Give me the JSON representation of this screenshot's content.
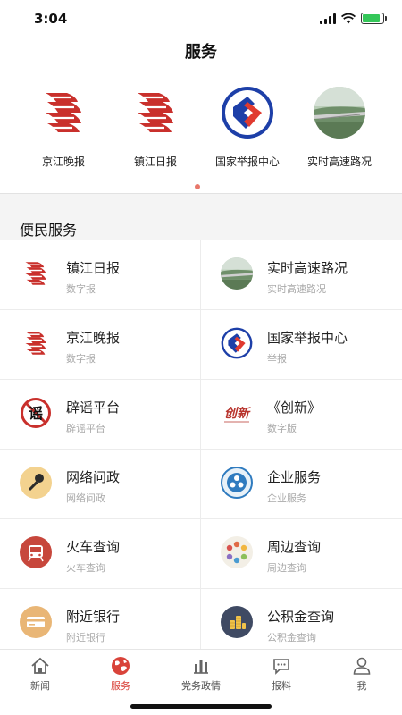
{
  "status_bar": {
    "time": "3:04",
    "battery_level": 0.85,
    "battery_color": "#34c759"
  },
  "header": {
    "title": "服务"
  },
  "carousel": {
    "items": [
      {
        "label": "京江晚报",
        "icon": "jingjiang-evening-news-logo"
      },
      {
        "label": "镇江日报",
        "icon": "zhenjiang-daily-logo"
      },
      {
        "label": "国家举报中心",
        "icon": "national-report-center-logo"
      },
      {
        "label": "实时高速路况",
        "icon": "highway-traffic-photo"
      }
    ],
    "active_page": 1,
    "page_count": 1
  },
  "section": {
    "title": "便民服务"
  },
  "services": [
    {
      "title": "镇江日报",
      "subtitle": "数字报",
      "icon": "zhenjiang-daily-logo"
    },
    {
      "title": "实时高速路况",
      "subtitle": "实时高速路况",
      "icon": "highway-traffic-photo"
    },
    {
      "title": "京江晚报",
      "subtitle": "数字报",
      "icon": "jingjiang-evening-news-logo"
    },
    {
      "title": "国家举报中心",
      "subtitle": "举报",
      "icon": "national-report-center-logo"
    },
    {
      "title": "辟谣平台",
      "subtitle": "辟谣平台",
      "icon": "rumor-refute-logo",
      "logo_text": "谣"
    },
    {
      "title": "《创新》",
      "subtitle": "数字版",
      "icon": "innovation-magazine-logo",
      "logo_text": "创新"
    },
    {
      "title": "网络问政",
      "subtitle": "网络问政",
      "icon": "microphone-icon"
    },
    {
      "title": "企业服务",
      "subtitle": "企业服务",
      "icon": "enterprise-service-icon"
    },
    {
      "title": "火车查询",
      "subtitle": "火车查询",
      "icon": "train-icon"
    },
    {
      "title": "周边查询",
      "subtitle": "周边查询",
      "icon": "nearby-icon"
    },
    {
      "title": "附近银行",
      "subtitle": "附近银行",
      "icon": "bank-card-icon"
    },
    {
      "title": "公积金查询",
      "subtitle": "公积金查询",
      "icon": "coins-icon"
    }
  ],
  "tabbar": {
    "active_color": "#d9433a",
    "tabs": [
      {
        "label": "新闻",
        "icon": "home-icon",
        "active": false
      },
      {
        "label": "服务",
        "icon": "globe-icon",
        "active": true
      },
      {
        "label": "党务政情",
        "icon": "building-icon",
        "active": false
      },
      {
        "label": "报料",
        "icon": "chat-bubble-icon",
        "active": false
      },
      {
        "label": "我",
        "icon": "user-icon",
        "active": false
      }
    ]
  }
}
